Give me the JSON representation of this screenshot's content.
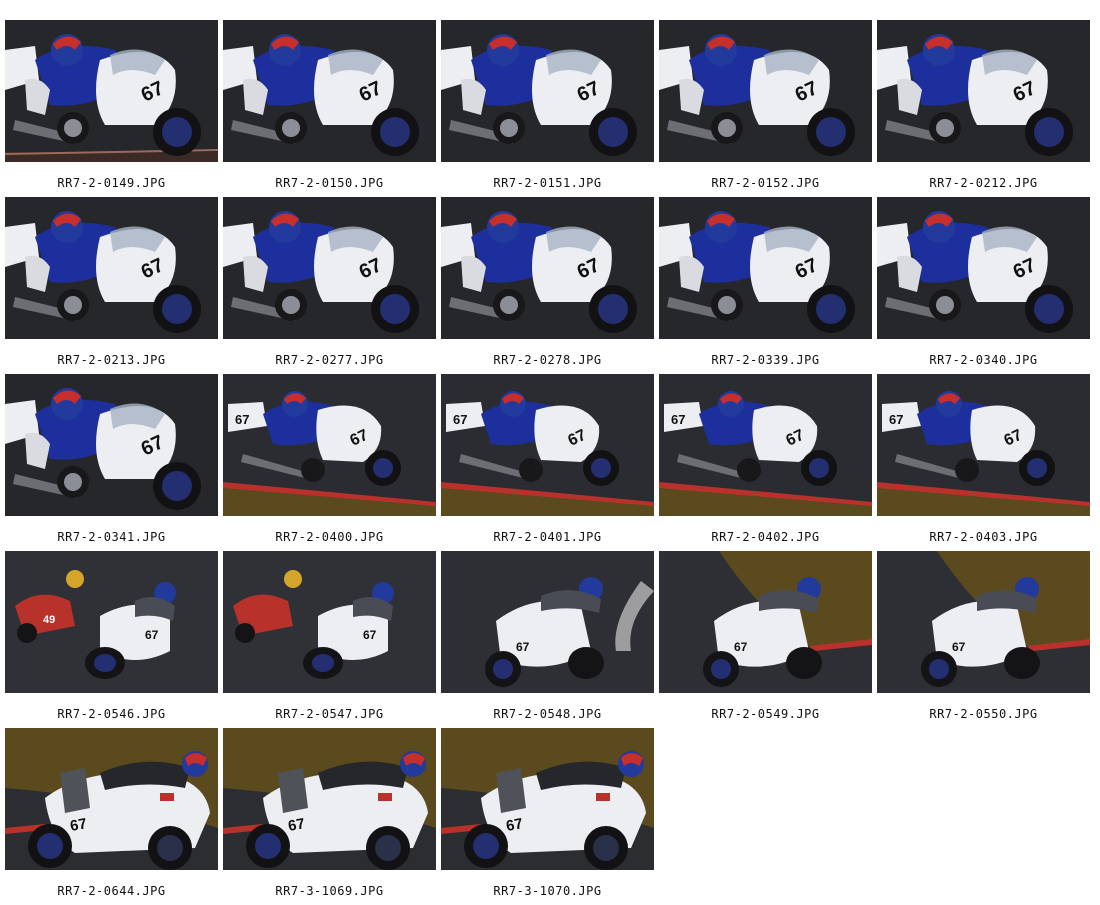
{
  "gallery": {
    "items": [
      {
        "filename": "RR7-2-0149.JPG",
        "scene": "closeup-lean",
        "number": "67"
      },
      {
        "filename": "RR7-2-0150.JPG",
        "scene": "closeup-lean",
        "number": "67"
      },
      {
        "filename": "RR7-2-0151.JPG",
        "scene": "closeup-lean",
        "number": "67"
      },
      {
        "filename": "RR7-2-0152.JPG",
        "scene": "closeup-lean",
        "number": "67"
      },
      {
        "filename": "RR7-2-0212.JPG",
        "scene": "closeup-lean",
        "number": "67"
      },
      {
        "filename": "RR7-2-0213.JPG",
        "scene": "closeup-lean",
        "number": "67"
      },
      {
        "filename": "RR7-2-0277.JPG",
        "scene": "closeup-lean",
        "number": "67"
      },
      {
        "filename": "RR7-2-0278.JPG",
        "scene": "closeup-lean",
        "number": "67"
      },
      {
        "filename": "RR7-2-0339.JPG",
        "scene": "closeup-lean",
        "number": "67"
      },
      {
        "filename": "RR7-2-0340.JPG",
        "scene": "closeup-lean",
        "number": "67"
      },
      {
        "filename": "RR7-2-0341.JPG",
        "scene": "closeup-lean",
        "number": "67"
      },
      {
        "filename": "RR7-2-0400.JPG",
        "scene": "kerb-lean",
        "number": "67"
      },
      {
        "filename": "RR7-2-0401.JPG",
        "scene": "kerb-lean",
        "number": "67"
      },
      {
        "filename": "RR7-2-0402.JPG",
        "scene": "kerb-lean",
        "number": "67"
      },
      {
        "filename": "RR7-2-0403.JPG",
        "scene": "kerb-lean",
        "number": "67"
      },
      {
        "filename": "RR7-2-0546.JPG",
        "scene": "two-bikes",
        "number": "67",
        "rival_number": "49"
      },
      {
        "filename": "RR7-2-0547.JPG",
        "scene": "two-bikes",
        "number": "67"
      },
      {
        "filename": "RR7-2-0548.JPG",
        "scene": "front-track",
        "number": "67"
      },
      {
        "filename": "RR7-2-0549.JPG",
        "scene": "front-grass",
        "number": "67"
      },
      {
        "filename": "RR7-2-0550.JPG",
        "scene": "front-grass",
        "number": "67"
      },
      {
        "filename": "RR7-2-0644.JPG",
        "scene": "side-grass",
        "number": "67"
      },
      {
        "filename": "RR7-3-1069.JPG",
        "scene": "side-grass",
        "number": "67"
      },
      {
        "filename": "RR7-3-1070.JPG",
        "scene": "side-grass",
        "number": "67"
      }
    ]
  },
  "colors": {
    "page_background": "#ffffff",
    "caption_text": "#111111",
    "track_asphalt": "#2a2b2f",
    "fairing_white": "#eceef2",
    "rider_blue": "#1c2f9c",
    "kerb_red": "#b8322b",
    "grass": "#5a4a1e"
  }
}
